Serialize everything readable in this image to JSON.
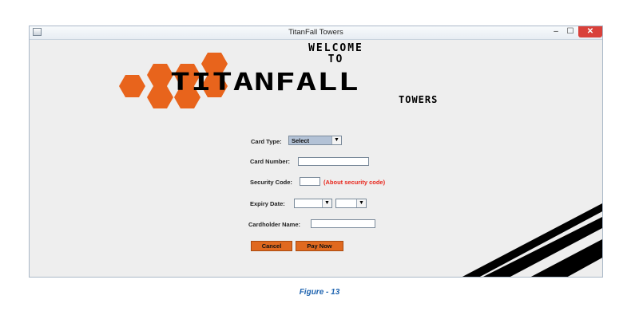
{
  "window": {
    "title": "TitanFall Towers",
    "controls": {
      "minimize": "–",
      "maximize": "☐",
      "close": "✕"
    }
  },
  "logo": {
    "welcome_line1": "WELCOME",
    "welcome_line2": "TO",
    "name": "TITANFALL",
    "subtitle": "TOWERS",
    "hex_color": "#e8641c",
    "stripe_color": "#000000"
  },
  "form": {
    "card_type": {
      "label": "Card Type:",
      "selected": "Select"
    },
    "card_number": {
      "label": "Card Number:",
      "value": ""
    },
    "security_code": {
      "label": "Security Code:",
      "value": "",
      "help_link": "(About security code)"
    },
    "expiry_date": {
      "label": "Expiry Date:",
      "month": "",
      "year": ""
    },
    "cardholder_name": {
      "label": "Cardholder Name:",
      "value": ""
    },
    "buttons": {
      "cancel": "Cancel",
      "pay_now": "Pay Now"
    }
  },
  "caption": "Figure - 13",
  "colors": {
    "button_orange": "#e0691f",
    "link_red": "#e8261c",
    "caption_blue": "#1f64b0",
    "select_highlight": "#b3c2d6"
  }
}
